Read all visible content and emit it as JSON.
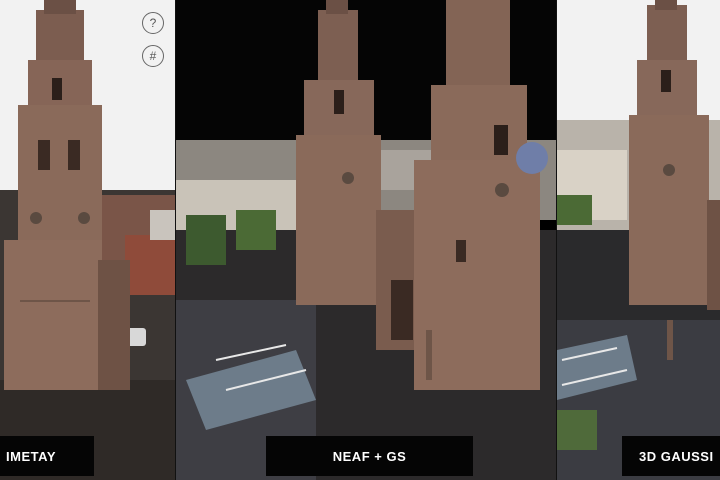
{
  "panels": [
    {
      "id": "p1",
      "label": "METAY",
      "label_visible": "IMETAY"
    },
    {
      "id": "p2",
      "label": "NEAF + GS"
    },
    {
      "id": "p3",
      "label": "3D GAUSSI"
    }
  ],
  "controls": {
    "help_glyph": "?",
    "grid_glyph": "#"
  },
  "colors": {
    "stone": "#8a6a5a",
    "stone_dark": "#5e4438",
    "sky_light": "#f2f2f2",
    "sky_dark": "#050505",
    "label_bg": "#050505"
  },
  "icons": [
    "help-icon",
    "grid-icon"
  ]
}
